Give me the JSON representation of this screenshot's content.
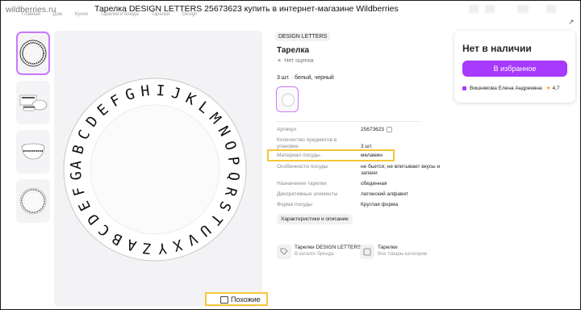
{
  "browser": {
    "site": "wildberries.ru",
    "page_title": "Тарелка DESIGN LETTERS 25673623 купить в интернет-магазине Wildberries"
  },
  "breadcrumbs": [
    "Главная",
    "Дом",
    "Кухня",
    "Тарелки и блюда",
    "Тарелки",
    "Design"
  ],
  "gallery": {
    "thumbnails": [
      "plate-thumb",
      "set-thumb",
      "bowl-thumb",
      "dish-thumb"
    ],
    "similar_label": "Похожие"
  },
  "product": {
    "brand": "DESIGN LETTERS",
    "title": "Тарелка",
    "rating_text": "Нет оценок",
    "variant": "3 шт. · белый, черный"
  },
  "specs": [
    {
      "key": "Артикул",
      "value": "25673623"
    },
    {
      "key": "Количество предметов в упаковке",
      "value": "3 шт."
    },
    {
      "key": "Материал посуды",
      "value": "меламин"
    },
    {
      "key": "Особенности посуды",
      "value": "не бьется; не впитывает вкусы и запахи"
    },
    {
      "key": "Назначение тарелки",
      "value": "обеденная"
    },
    {
      "key": "Декоративные элементы",
      "value": "латинский алфавит"
    },
    {
      "key": "Форма посуды",
      "value": "Круглая форма"
    }
  ],
  "characteristics_button": "Характеристики и описание",
  "links": [
    {
      "title": "Тарелки DESIGN LETTERS",
      "subtitle": "В каталог бренда"
    },
    {
      "title": "Тарелки",
      "subtitle": "Все товары категории"
    }
  ],
  "purchase": {
    "status": "Нет в наличии",
    "favorite_label": "В избранное",
    "seller": "Вишнякова Елена Андреевна",
    "seller_rating": "4,7"
  },
  "plate_letters": "ABCDEFGHIJKLMNOPQRSTUVXYZ",
  "colors": {
    "accent": "#a73afd",
    "highlight": "#f3c73a",
    "selected_border": "#c978ff"
  }
}
